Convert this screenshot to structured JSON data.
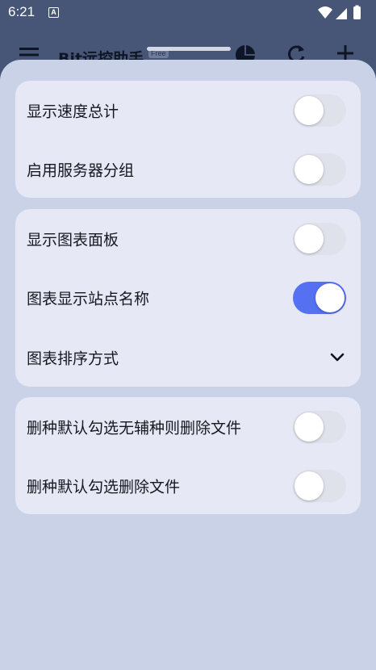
{
  "status_bar": {
    "time": "6:21",
    "notification_letter": "A",
    "icons": [
      "wifi-icon",
      "cellular-signal-icon",
      "battery-icon"
    ]
  },
  "app_bar": {
    "title": "Bit远控助手",
    "badge": "Free",
    "icons": [
      "menu-icon",
      "pie-chart-icon",
      "refresh-icon",
      "add-icon"
    ]
  },
  "settings": {
    "group1": {
      "show_speed_total": {
        "label": "显示速度总计",
        "enabled": false
      },
      "enable_server_groups": {
        "label": "启用服务器分组",
        "enabled": false
      }
    },
    "group2": {
      "show_chart_panel": {
        "label": "显示图表面板",
        "enabled": false
      },
      "chart_show_site_name": {
        "label": "图表显示站点名称",
        "enabled": true
      },
      "chart_sort_method": {
        "label": "图表排序方式",
        "icon": "chevron-down-icon"
      }
    },
    "group3": {
      "delete_default_no_aux": {
        "label": "删种默认勾选无辅种则删除文件",
        "enabled": false
      },
      "delete_default_files": {
        "label": "删种默认勾选删除文件",
        "enabled": false
      }
    }
  },
  "colors": {
    "accent": "#5670f2",
    "sheet_bg": "#c9d2e6",
    "card_bg": "#e6e9f5",
    "switch_off": "#dfe2ea"
  }
}
